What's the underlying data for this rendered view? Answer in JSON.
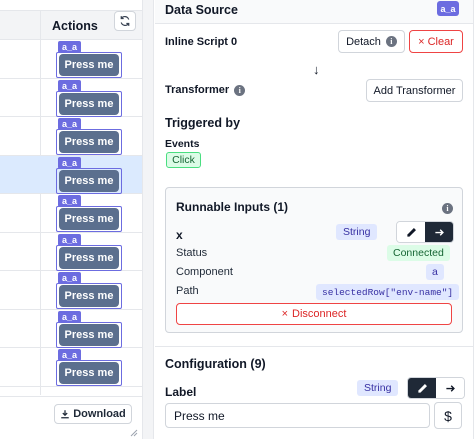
{
  "table": {
    "actions_header": "Actions",
    "row_tag": "a_a",
    "row_button_label": "Press me",
    "rows": [
      {
        "selected": false
      },
      {
        "selected": false
      },
      {
        "selected": false
      },
      {
        "selected": true
      },
      {
        "selected": false
      },
      {
        "selected": false
      },
      {
        "selected": false
      },
      {
        "selected": false
      },
      {
        "selected": false
      }
    ],
    "download_label": "Download"
  },
  "panel": {
    "title": "Data Source",
    "component_id": "a_a",
    "inline_script_label": "Inline Script 0",
    "detach_label": "Detach",
    "clear_label": "Clear",
    "transformer_label": "Transformer",
    "add_transformer_label": "Add Transformer",
    "triggered_by_title": "Triggered by",
    "events_label": "Events",
    "event_click": "Click",
    "runnable_inputs": {
      "title": "Runnable Inputs (1)",
      "input_name": "x",
      "type_badge": "String",
      "status_label": "Status",
      "status_value": "Connected",
      "component_label": "Component",
      "component_value": "a",
      "path_label": "Path",
      "path_value": "selectedRow[\"env-name\"]",
      "disconnect_label": "Disconnect"
    },
    "configuration_title": "Configuration (9)",
    "label_field": {
      "label": "Label",
      "type_badge": "String",
      "value": "Press me"
    },
    "dollar_label": "$"
  },
  "colors": {
    "accent": "#6c6ce0",
    "button_fill": "#5b6f8e",
    "danger": "#dc2626",
    "success_bg": "#dcfce7",
    "selected_row": "#dbeafe"
  }
}
